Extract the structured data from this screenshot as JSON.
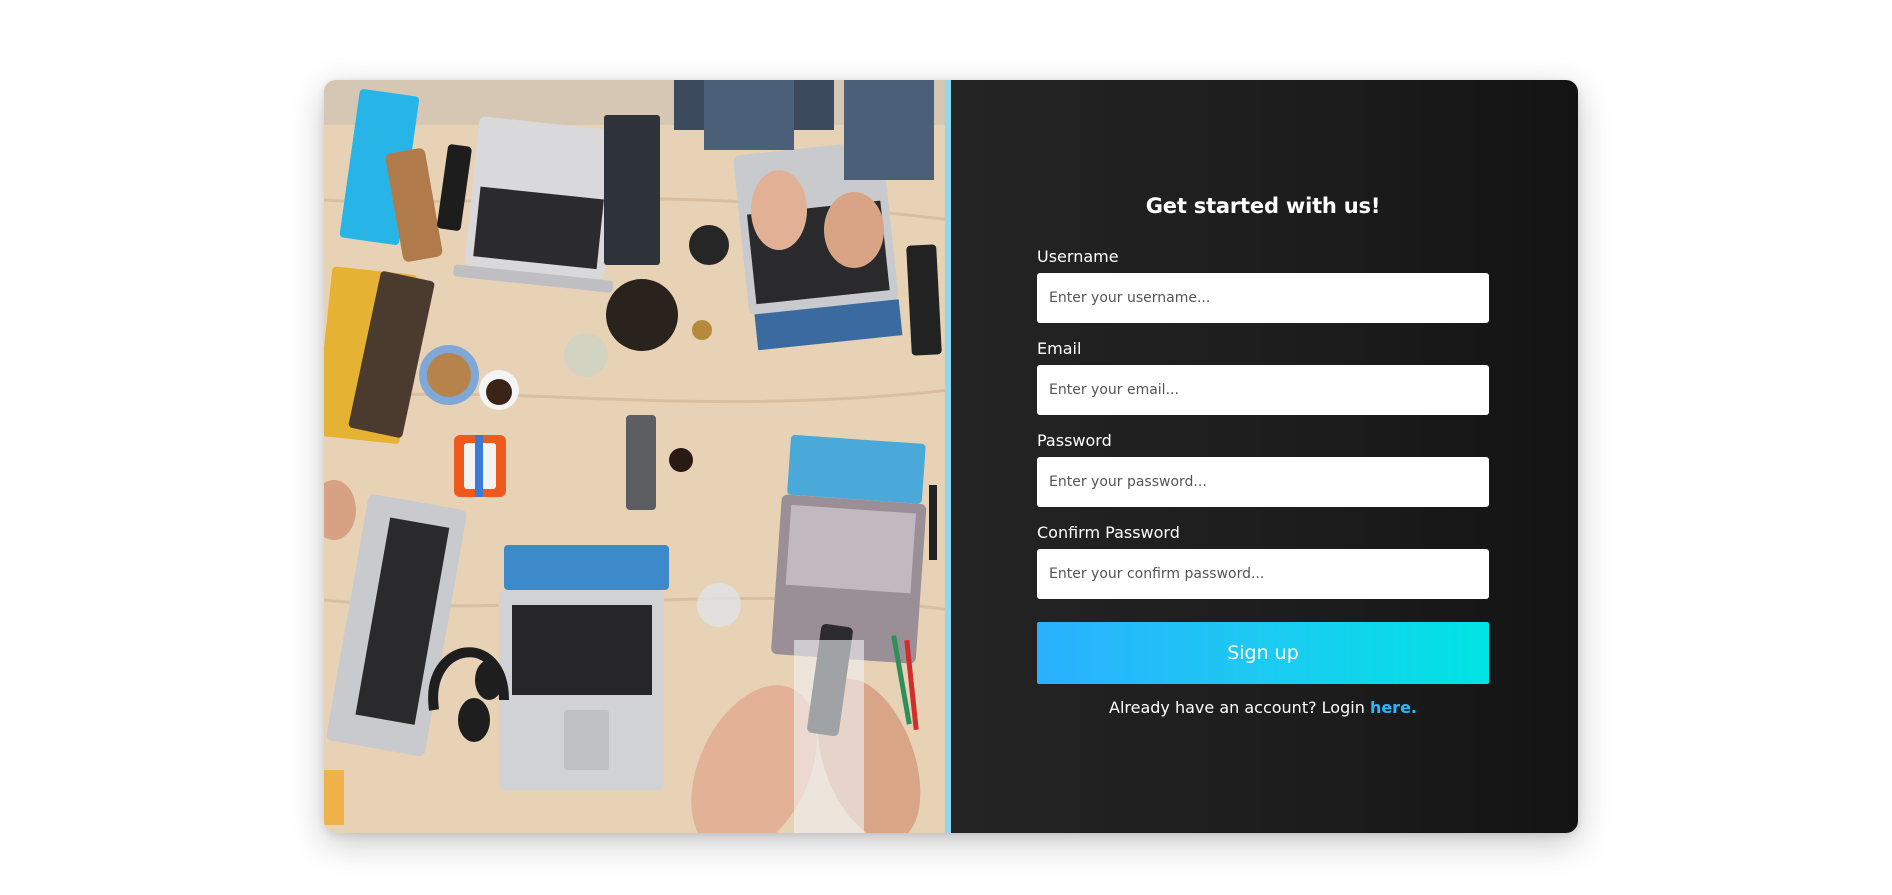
{
  "colors": {
    "panel_background": "#1c1c1c",
    "button_gradient_start": "#2ab0ff",
    "button_gradient_end": "#00e3e3",
    "link": "#29b8ff"
  },
  "hero_image": {
    "icon": "workspace-desk-photo"
  },
  "form": {
    "title": "Get started with us!",
    "fields": [
      {
        "label": "Username",
        "placeholder": "Enter your username..."
      },
      {
        "label": "Email",
        "placeholder": "Enter your email..."
      },
      {
        "label": "Password",
        "placeholder": "Enter your password..."
      },
      {
        "label": "Confirm Password",
        "placeholder": "Enter your confirm password..."
      }
    ],
    "submit_label": "Sign up",
    "login_prompt": "Already have an account? Login",
    "login_link": "here."
  }
}
